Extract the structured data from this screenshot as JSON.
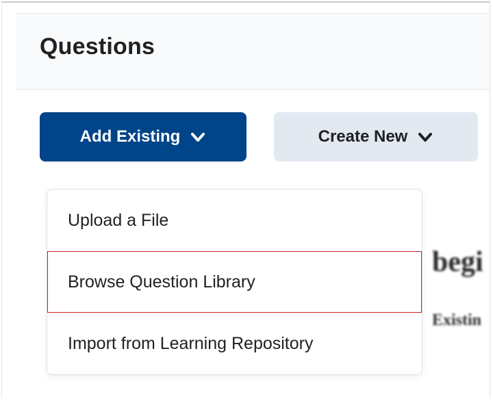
{
  "section": {
    "title": "Questions"
  },
  "buttons": {
    "add_existing": {
      "label": "Add Existing"
    },
    "create_new": {
      "label": "Create New"
    }
  },
  "dropdown": {
    "items": [
      {
        "label": "Upload a File"
      },
      {
        "label": "Browse Question Library"
      },
      {
        "label": "Import from Learning Repository"
      }
    ]
  },
  "background_fragments": {
    "begi": "begi",
    "exist": "Existin"
  }
}
